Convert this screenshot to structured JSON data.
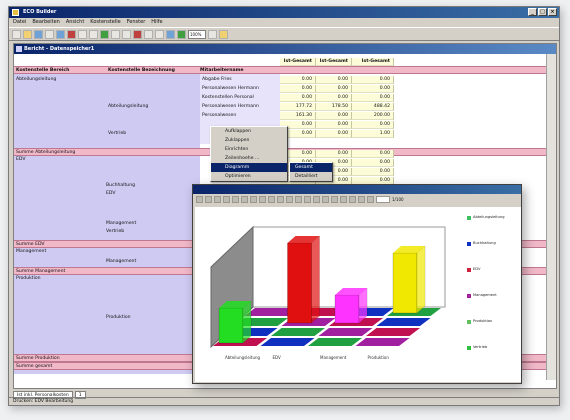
{
  "app": {
    "title": "ECO Builder"
  },
  "menu": [
    "Datei",
    "Bearbeiten",
    "Ansicht",
    "Kostenstelle",
    "Fenster",
    "Hilfe"
  ],
  "toolbar": {
    "zoom": "100%"
  },
  "document": {
    "title": "Bericht - Datenspeicher1"
  },
  "table": {
    "col_headers": [
      "Kostenstelle Bereich",
      "Kostenstelle Bezeichnung",
      "Mitarbeitername",
      "Ist-Gesamt",
      "Ist-Gesamt",
      "Ist-Gesamt"
    ],
    "rows": [
      {
        "a": "Abteilungsleitung",
        "b": "",
        "c": "Abgabe Fries",
        "v": [
          "0.00",
          "0.00",
          "0.00"
        ]
      },
      {
        "a": "",
        "b": "",
        "c": "Personalwesen Hermann",
        "v": [
          "0.00",
          "0.00",
          "0.00"
        ]
      },
      {
        "a": "",
        "b": "",
        "c": "Kostenstellen Personal",
        "v": [
          "0.00",
          "0.00",
          "0.00"
        ]
      },
      {
        "a": "",
        "b": "Abteilungsleitung",
        "c": "Personalwesen Hermann",
        "v": [
          "177.72",
          "178.50",
          "488.42"
        ]
      },
      {
        "a": "",
        "b": "",
        "c": "Personalwesen",
        "v": [
          "161.30",
          "0.00",
          "200.00"
        ]
      },
      {
        "a": "",
        "b": "",
        "c": "",
        "v": [
          "0.00",
          "0.00",
          "0.00"
        ]
      },
      {
        "a": "",
        "b": "Vertrieb",
        "c": "",
        "v": [
          "0.00",
          "0.00",
          "1.00"
        ]
      }
    ],
    "sum_rows": [
      "Summe Abteilungsleitung",
      "Summe EDV",
      "Summe Management",
      "Summe Produktion",
      "Summe gesamt"
    ],
    "groups": [
      "EDV",
      "Buchhaltung",
      "EDV",
      "Management",
      "Vertrieb",
      "Management",
      "Management",
      "Produktion",
      "Produktion"
    ],
    "extra_values": [
      [
        "0.00",
        "0.00",
        "0.00"
      ],
      [
        "0.00",
        "0.00",
        "0.00"
      ],
      [
        "0.00",
        "0.00",
        "0.00"
      ],
      [
        "0.00",
        "0.00",
        "0.00"
      ],
      [
        "0.00",
        "0.00",
        "0.00"
      ]
    ]
  },
  "context_menu": {
    "items": [
      "Aufklappen",
      "Zuklappen",
      "Einrichten",
      "Zeilenhoehe ...",
      "Diagramm",
      "Optimieren"
    ],
    "submenu": [
      "Gesamt",
      "Detailliert"
    ]
  },
  "chart_window": {
    "ruler": "1/100"
  },
  "chart_data": {
    "type": "bar",
    "categories": [
      "Abteilungsleitung",
      "EDV",
      "Management",
      "Produktion"
    ],
    "series": [
      {
        "name": "Abteilungsleitung",
        "values": [
          0.35,
          0,
          0,
          0
        ]
      },
      {
        "name": "EDV",
        "values": [
          0,
          0.8,
          0,
          0
        ]
      },
      {
        "name": "Management",
        "values": [
          0,
          0,
          0.28,
          0
        ]
      },
      {
        "name": "Produktion",
        "values": [
          0,
          0,
          0,
          0.6
        ]
      }
    ],
    "colors": [
      "#22dd22",
      "#e01010",
      "#ff33ff",
      "#f0e800"
    ]
  },
  "legend": [
    {
      "label": "Abteilungsleitung",
      "color": "#3cc060"
    },
    {
      "label": "Buchhaltung",
      "color": "#1030c0"
    },
    {
      "label": "EDV",
      "color": "#d02040"
    },
    {
      "label": "Management",
      "color": "#a020a0"
    },
    {
      "label": "Produktion",
      "color": "#60c060"
    },
    {
      "label": "Vertrieb",
      "color": "#30c040"
    }
  ],
  "tabs": [
    "Ist inkl. Personalkosten",
    "1"
  ],
  "status": "Drucken: EDV Bearbeitung"
}
